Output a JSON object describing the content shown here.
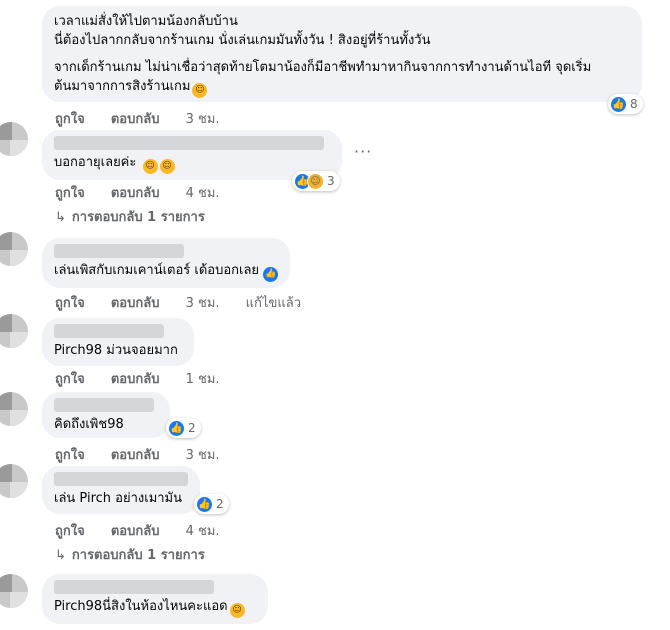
{
  "comments": [
    {
      "lines": [
        "เวลาแม่สั่งให้ไปตามน้องกลับบ้าน",
        "นี่ต้องไปลากกลับจากร้านเกม นั่งเล่นเกมมันทั้งวัน ! สิงอยู่ที่ร้านทั้งวัน"
      ],
      "lines2": [
        "จากเด็กร้านเกม ไม่น่าเชื่อว่าสุดท้ายโตมาน้องก็มีอาชีพทำมาหากินจากการทำงานด้านไอที จุดเริ่ม",
        "ต้นมาจากการสิงร้านเกม"
      ],
      "reaction_count": "8",
      "like": "ถูกใจ",
      "reply": "ตอบกลับ",
      "time": "3 ชม."
    },
    {
      "text": "บอกอายุเลยค่ะ",
      "reaction_count": "3",
      "like": "ถูกใจ",
      "reply": "ตอบกลับ",
      "time": "4 ชม.",
      "replies_link": "การตอบกลับ 1 รายการ"
    },
    {
      "text": "เล่นเพิสกับเกมเคาน์เตอร์ เด้อบอกเลย",
      "like": "ถูกใจ",
      "reply": "ตอบกลับ",
      "time": "3 ชม.",
      "edited": "แก้ไขแล้ว"
    },
    {
      "text": "Pirch98 ม่วนจอยมาก",
      "like": "ถูกใจ",
      "reply": "ตอบกลับ",
      "time": "1 ชม."
    },
    {
      "text": "คิดถึงเพิช98",
      "reaction_count": "2",
      "like": "ถูกใจ",
      "reply": "ตอบกลับ",
      "time": "3 ชม."
    },
    {
      "text": "เล่น Pirch อย่างเมามัน",
      "reaction_count": "2",
      "like": "ถูกใจ",
      "reply": "ตอบกลับ",
      "time": "4 ชม.",
      "replies_link": "การตอบกลับ 1 รายการ"
    },
    {
      "text": "Pirch98นี่สิงในห้องไหนคะแอด"
    }
  ],
  "icons": {
    "like": "like-icon",
    "haha": "haha-icon",
    "more": "more-options-icon",
    "reply_arrow": "reply-arrow-icon",
    "emoji": "emoji-icon"
  },
  "colors": {
    "bubble": "#f0f2f5",
    "like_blue": "#1877f2",
    "meta": "#65676b"
  }
}
